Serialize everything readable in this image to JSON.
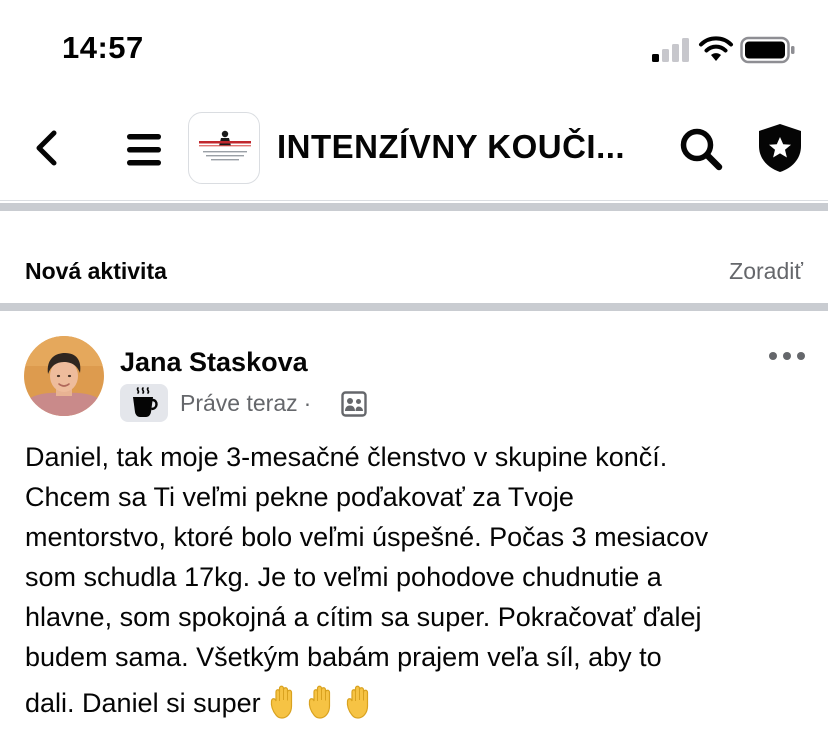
{
  "status_bar": {
    "time": "14:57",
    "icons": [
      "cellular-signal-icon",
      "wifi-icon",
      "battery-icon"
    ]
  },
  "header": {
    "back_icon": "chevron-left-icon",
    "menu_icon": "hamburger-menu-icon",
    "group_avatar": "group-logo",
    "group_title": "INTENZÍVNY KOUČI...",
    "search_icon": "search-icon",
    "admin_icon": "shield-star-icon"
  },
  "feed": {
    "section_label": "Nová aktivita",
    "sort_label": "Zoradiť"
  },
  "post": {
    "author": "Jana Staskova",
    "badge_icon": "coffee-cup-icon",
    "time": "Práve teraz",
    "separator": "·",
    "privacy_icon": "group-members-icon",
    "more_icon": "more-horizontal-icon",
    "text_lines": [
      "Daniel, tak moje 3-mesačné členstvo v skupine končí.",
      "Chcem sa Ti veľmi pekne poďakovať za Tvoje",
      "mentorstvo, ktoré bolo veľmi úspešné. Počas 3 mesiacov",
      "som schudla 17kg. Je to veľmi pohodove chudnutie a",
      "hlavne, som spokojná a cítim sa super. Pokračovať ďalej",
      "budem sama. Všetkým babám prajem veľa síl, aby to",
      "dali. Daniel si super"
    ],
    "emojis": [
      "raised-hand",
      "raised-hand",
      "raised-hand"
    ]
  },
  "colors": {
    "text_primary": "#050505",
    "text_secondary": "#65676b",
    "divider": "#c9ccd1",
    "badge_bg": "#e4e6eb",
    "emoji_yellow": "#f6c344"
  }
}
